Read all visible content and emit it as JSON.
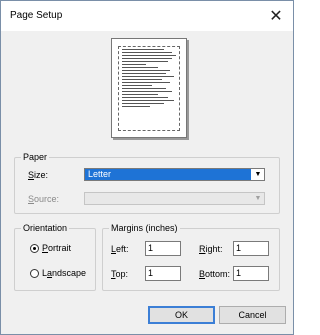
{
  "window": {
    "title": "Page Setup",
    "close_icon": "close-icon"
  },
  "paper": {
    "legend": "Paper",
    "size_label": "Size:",
    "size_value": "Letter",
    "source_label": "Source:",
    "source_value": ""
  },
  "orientation": {
    "legend": "Orientation",
    "options": [
      {
        "label": "Portrait",
        "selected": true
      },
      {
        "label": "Landscape",
        "selected": false
      }
    ]
  },
  "margins": {
    "legend": "Margins (inches)",
    "left_label": "Left:",
    "left_value": "1",
    "right_label": "Right:",
    "right_value": "1",
    "top_label": "Top:",
    "top_value": "1",
    "bottom_label": "Bottom:",
    "bottom_value": "1"
  },
  "buttons": {
    "ok": "OK",
    "cancel": "Cancel"
  },
  "colors": {
    "selection": "#1e73d6",
    "window_bg": "#f0f0f0"
  }
}
